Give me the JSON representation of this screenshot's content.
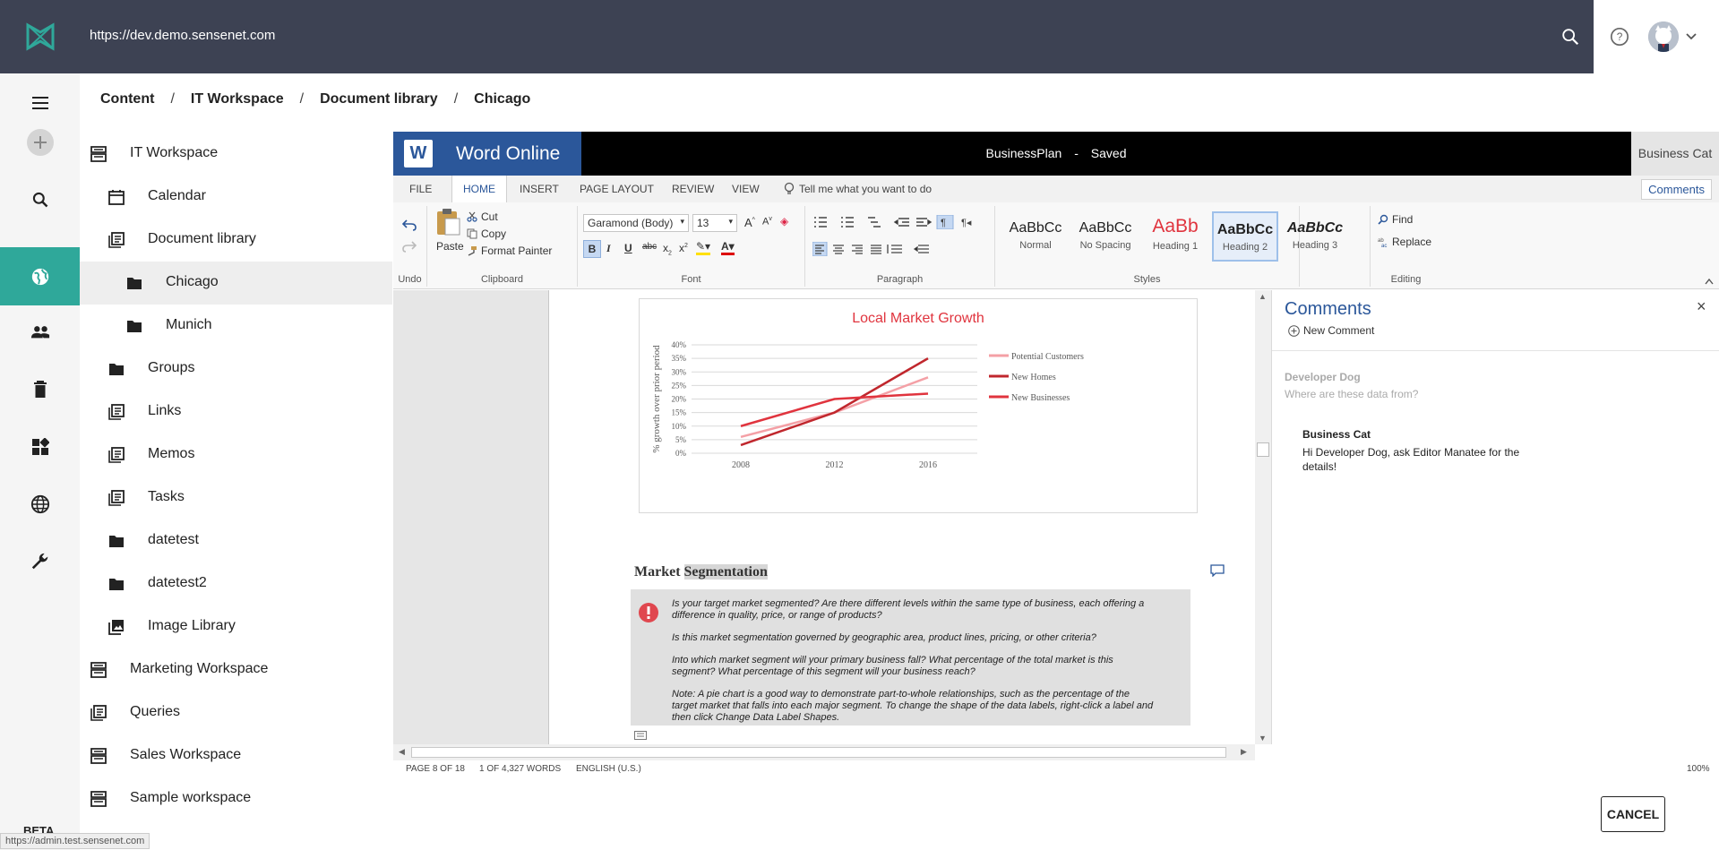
{
  "header": {
    "url": "https://dev.demo.sensenet.com",
    "search_icon": "search-icon",
    "help_icon": "help-icon",
    "avatar": "user-avatar",
    "chevron": "chevron-down-icon"
  },
  "leftnav": {
    "items": [
      "add-icon",
      "search-icon",
      "globe-icon",
      "users-icon",
      "trash-icon",
      "dashboard-icon",
      "language-icon",
      "wrench-icon"
    ],
    "active": "globe-icon",
    "beta_label": "BETA"
  },
  "status_url": "https://admin.test.sensenet.com",
  "breadcrumb": {
    "items": [
      "Content",
      "IT Workspace",
      "Document library",
      "Chicago"
    ],
    "separator": "/"
  },
  "tree": {
    "items": [
      {
        "label": "IT Workspace",
        "icon": "workspace-icon",
        "level": 0
      },
      {
        "label": "Calendar",
        "icon": "calendar-icon",
        "level": 1
      },
      {
        "label": "Document library",
        "icon": "library-icon",
        "level": 1
      },
      {
        "label": "Chicago",
        "icon": "folder-icon",
        "level": 2,
        "selected": true
      },
      {
        "label": "Munich",
        "icon": "folder-icon",
        "level": 2
      },
      {
        "label": "Groups",
        "icon": "folder-icon",
        "level": 1
      },
      {
        "label": "Links",
        "icon": "library-icon",
        "level": 1
      },
      {
        "label": "Memos",
        "icon": "library-icon",
        "level": 1
      },
      {
        "label": "Tasks",
        "icon": "library-icon",
        "level": 1
      },
      {
        "label": "datetest",
        "icon": "folder-icon",
        "level": 1
      },
      {
        "label": "datetest2",
        "icon": "folder-icon",
        "level": 1
      },
      {
        "label": "Image Library",
        "icon": "image-icon",
        "level": 1
      },
      {
        "label": "Marketing Workspace",
        "icon": "workspace-icon",
        "level": 0
      },
      {
        "label": "Queries",
        "icon": "library-icon",
        "level": 0
      },
      {
        "label": "Sales Workspace",
        "icon": "workspace-icon",
        "level": 0
      },
      {
        "label": "Sample workspace",
        "icon": "workspace-icon",
        "level": 0
      }
    ]
  },
  "word": {
    "brand": "Word Online",
    "logo_letter": "W",
    "doc_name": "BusinessPlan",
    "doc_sep": "-",
    "doc_status": "Saved",
    "user": "Business Cat",
    "tabs": [
      "FILE",
      "HOME",
      "INSERT",
      "PAGE LAYOUT",
      "REVIEW",
      "VIEW"
    ],
    "active_tab": "HOME",
    "tell_me": "Tell me what you want to do",
    "comments_button": "Comments",
    "ribbon": {
      "undo_label": "Undo",
      "clipboard_label": "Clipboard",
      "paste": "Paste",
      "cut": "Cut",
      "copy": "Copy",
      "format_painter": "Format Painter",
      "font_label": "Font",
      "font_name": "Garamond (Body)",
      "font_size": "13",
      "paragraph_label": "Paragraph",
      "styles_label": "Styles",
      "editing_label": "Editing",
      "find": "Find",
      "replace": "Replace",
      "styles": [
        {
          "preview": "AaBbCc",
          "name": "Normal"
        },
        {
          "preview": "AaBbCc",
          "name": "No Spacing"
        },
        {
          "preview": "AaBb",
          "name": "Heading 1"
        },
        {
          "preview": "AaBbCc",
          "name": "Heading 2",
          "selected": true
        },
        {
          "preview": "AaBbCc",
          "name": "Heading 3"
        }
      ]
    },
    "status": {
      "page": "PAGE 8 OF 18",
      "words": "1 OF 4,327 WORDS",
      "language": "ENGLISH (U.S.)",
      "zoom": "100%"
    }
  },
  "document": {
    "section_heading_plain": "Market",
    "section_heading_highlight": "Segmentation",
    "info_paragraphs": [
      "Is your target market segmented? Are there different levels within the same type of business, each offering a difference in quality, price, or range of products?",
      "Is this market segmentation governed by geographic area, product lines, pricing, or other criteria?",
      "Into which market segment will your primary business fall? What percentage of the total market is this segment? What percentage of this segment will your business reach?",
      "Note: A pie chart is a good way to demonstrate part-to-whole relationships, such as the percentage of the target market that falls into each major segment. To change the shape of the data labels, right-click a label and then click Change Data Label Shapes."
    ]
  },
  "chart_data": {
    "type": "line",
    "title": "Local Market Growth",
    "ylabel": "% growth over prior period",
    "xlabel": "",
    "x": [
      "2008",
      "2012",
      "2016"
    ],
    "yticks": [
      "0%",
      "5%",
      "10%",
      "15%",
      "20%",
      "25%",
      "30%",
      "35%",
      "40%"
    ],
    "ylim": [
      0,
      40
    ],
    "grid": true,
    "legend": "right",
    "series": [
      {
        "name": "Potential Customers",
        "values": [
          6,
          15,
          28
        ],
        "color": "#f4a0a6"
      },
      {
        "name": "New Homes",
        "values": [
          3,
          15,
          35
        ],
        "color": "#c0272d"
      },
      {
        "name": "New Businesses",
        "values": [
          10,
          20,
          22
        ],
        "color": "#e0343e"
      }
    ]
  },
  "comments": {
    "title": "Comments",
    "new_comment": "New Comment",
    "entries": [
      {
        "author": "Developer Dog",
        "text": "Where are these data from?",
        "faded": true
      },
      {
        "author": "Business Cat",
        "text": "Hi Developer Dog, ask Editor Manatee for the details!",
        "faded": false
      }
    ]
  },
  "cancel_button": "CANCEL"
}
